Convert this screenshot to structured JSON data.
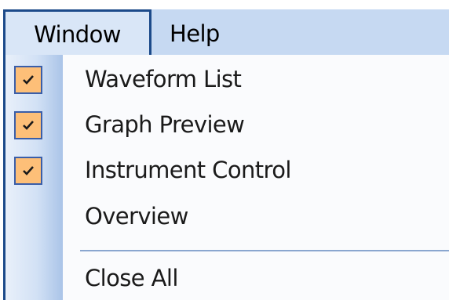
{
  "menubar": {
    "window_label": "Window",
    "help_label": "Help"
  },
  "dropdown": {
    "items": [
      {
        "label": "Waveform List",
        "checked": true,
        "icon": "checkmark-icon"
      },
      {
        "label": "Graph Preview",
        "checked": true,
        "icon": "checkmark-icon"
      },
      {
        "label": "Instrument Control",
        "checked": true,
        "icon": "checkmark-icon"
      },
      {
        "label": "Overview",
        "checked": false
      }
    ],
    "close_all_label": "Close All"
  },
  "colors": {
    "menubar_bg": "#c6d9f2",
    "active_menu_border": "#1c4a8a",
    "check_bg": "#fdbf78",
    "check_border": "#3a5ea8"
  }
}
